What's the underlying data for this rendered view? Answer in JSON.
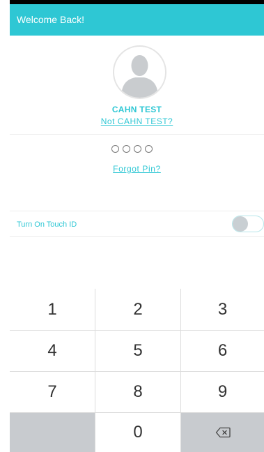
{
  "header": {
    "title": "Welcome Back!"
  },
  "user": {
    "name": "CAHN TEST",
    "not_user_link": "Not CAHN TEST?"
  },
  "pin": {
    "length": 4,
    "entered": 0
  },
  "forgot_pin_link": "Forgot Pin?",
  "touch_id": {
    "label": "Turn On Touch ID",
    "enabled": false
  },
  "keypad": {
    "keys": [
      "1",
      "2",
      "3",
      "4",
      "5",
      "6",
      "7",
      "8",
      "9",
      "",
      "0",
      "backspace"
    ]
  },
  "colors": {
    "accent": "#2ec7d4",
    "keypad_gray": "#c8cbcf",
    "avatar_gray": "#c9cccf"
  },
  "icons": {
    "avatar": "person-silhouette-icon",
    "backspace": "backspace-icon"
  }
}
